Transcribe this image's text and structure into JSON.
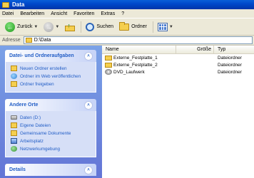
{
  "window": {
    "title": "Data"
  },
  "menu": [
    "Datei",
    "Bearbeiten",
    "Ansicht",
    "Favoriten",
    "Extras",
    "?"
  ],
  "toolbar": {
    "back_label": "Zurück",
    "search_label": "Suchen",
    "folders_label": "Ordner"
  },
  "address": {
    "label": "Adresse",
    "value": "D:\\Data"
  },
  "tasks": {
    "title": "Datei- und Ordneraufgaben",
    "items": [
      "Neuen Ordner erstellen",
      "Ordner im Web veröffentlichen",
      "Ordner freigeben"
    ]
  },
  "places": {
    "title": "Andere Orte",
    "items": [
      "Daten (D:)",
      "Eigene Dateien",
      "Gemeinsame Dokumente",
      "Arbeitsplatz",
      "Netzwerkumgebung"
    ]
  },
  "details": {
    "title": "Details"
  },
  "columns": {
    "name": "Name",
    "size": "Größe",
    "type": "Typ"
  },
  "files": [
    {
      "name": "Externe_Festplatte_1",
      "type": "Dateiordner",
      "icon": "folder-icon"
    },
    {
      "name": "Externe_Festplatte_2",
      "type": "Dateiordner",
      "icon": "folder-icon"
    },
    {
      "name": "DVD_Laufwerk",
      "type": "Dateiordner",
      "icon": "dvd-icon"
    }
  ],
  "colors": {
    "titlebar": "#0047c9",
    "task_link": "#215dc6",
    "pane": "#7ba2e7"
  }
}
